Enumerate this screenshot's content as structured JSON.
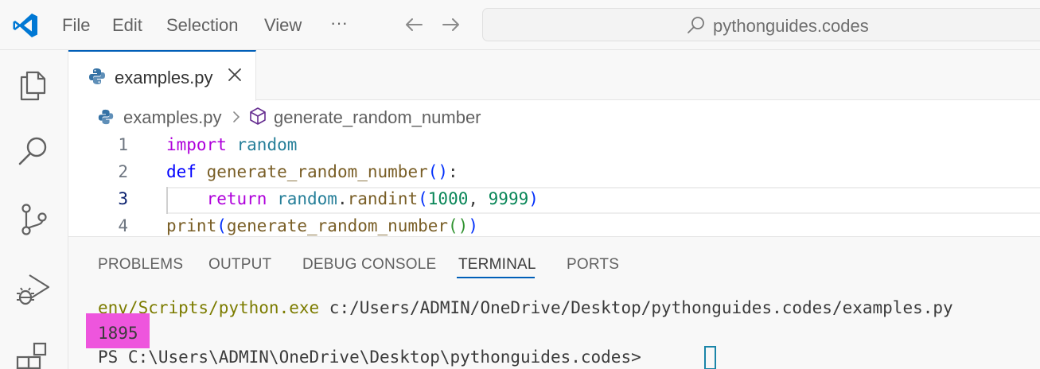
{
  "menu": {
    "file": "File",
    "edit": "Edit",
    "selection": "Selection",
    "view": "View",
    "more": "···"
  },
  "search": {
    "text": "pythonguides.codes"
  },
  "tab": {
    "label": "examples.py"
  },
  "breadcrumb": {
    "file": "examples.py",
    "symbol": "generate_random_number"
  },
  "editor": {
    "line_numbers": [
      "1",
      "2",
      "3",
      "4"
    ],
    "lines": [
      [
        {
          "t": "import",
          "c": "kw"
        },
        {
          "t": " "
        },
        {
          "t": "random",
          "c": "mod"
        }
      ],
      [
        {
          "t": "def",
          "c": "kw2"
        },
        {
          "t": " "
        },
        {
          "t": "generate_random_number",
          "c": "fn"
        },
        {
          "t": "()",
          "c": "p1"
        },
        {
          "t": ":"
        }
      ],
      [
        {
          "t": "    "
        },
        {
          "t": "return",
          "c": "kw"
        },
        {
          "t": " "
        },
        {
          "t": "random",
          "c": "mod"
        },
        {
          "t": "."
        },
        {
          "t": "randint",
          "c": "fn"
        },
        {
          "t": "(",
          "c": "p1"
        },
        {
          "t": "1000",
          "c": "num"
        },
        {
          "t": ", "
        },
        {
          "t": "9999",
          "c": "num"
        },
        {
          "t": ")",
          "c": "p1"
        }
      ],
      [
        {
          "t": "print",
          "c": "fn"
        },
        {
          "t": "(",
          "c": "p1"
        },
        {
          "t": "generate_random_number",
          "c": "fn"
        },
        {
          "t": "()",
          "c": "p2"
        },
        {
          "t": ")",
          "c": "p1"
        }
      ]
    ],
    "active_line": 3
  },
  "panel": {
    "tabs": [
      "PROBLEMS",
      "OUTPUT",
      "DEBUG CONSOLE",
      "TERMINAL",
      "PORTS"
    ],
    "active_tab": "TERMINAL"
  },
  "terminal": {
    "cmd_path": "env/Scripts/python.exe",
    "cmd_arg": " c:/Users/ADMIN/OneDrive/Desktop/pythonguides.codes/examples.py",
    "output": "1895",
    "prompt": "PS C:\\Users\\ADMIN\\OneDrive\\Desktop\\pythonguides.codes> "
  },
  "colors": {
    "accent": "#005fb8",
    "highlight": "#ee55dd",
    "vscode_blue": "#0078d4"
  },
  "icons": {
    "logo": "vscode-logo",
    "back": "arrow-left-icon",
    "forward": "arrow-right-icon",
    "search": "search-icon",
    "explorer": "files-icon",
    "search_view": "search-icon",
    "source_control": "source-control-icon",
    "run_debug": "run-debug-icon",
    "extensions": "extensions-icon"
  }
}
